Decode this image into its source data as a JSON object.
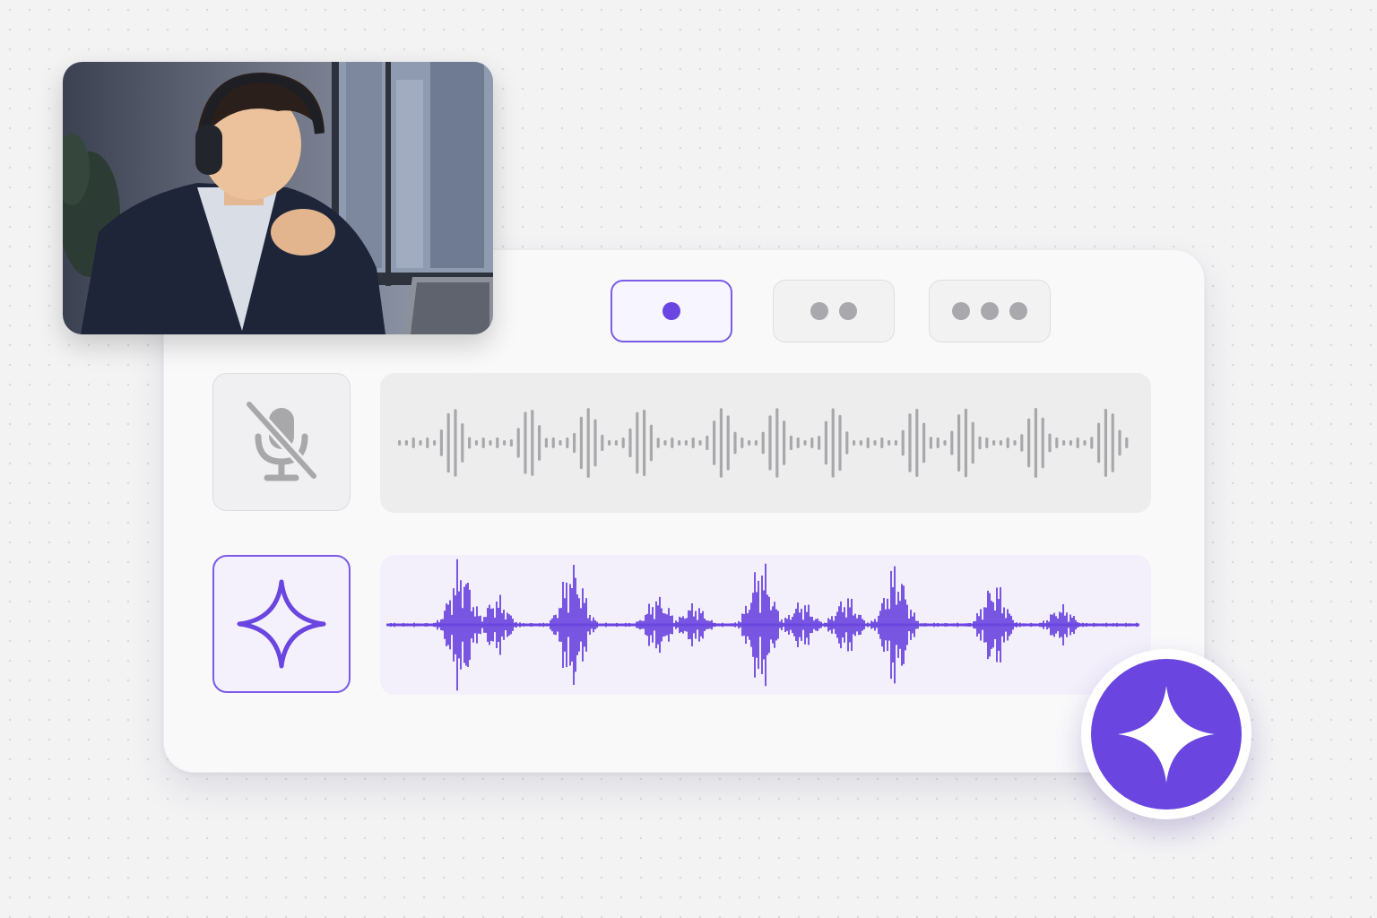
{
  "photo": {
    "subject": "man-with-headphones-at-laptop"
  },
  "modes": [
    {
      "id": "one",
      "dots": 1,
      "selected": true
    },
    {
      "id": "two",
      "dots": 2,
      "selected": false
    },
    {
      "id": "three",
      "dots": 3,
      "selected": false
    }
  ],
  "tracks": {
    "original": {
      "icon": "microphone-muted-icon",
      "state": "muted",
      "color": "#a8a8ab"
    },
    "ai": {
      "icon": "sparkle-icon",
      "state": "active",
      "color": "#6a45e0"
    }
  },
  "fab": {
    "icon": "sparkle-icon"
  },
  "colors": {
    "accent": "#6a45e0",
    "accent_border": "#7b5be6",
    "muted": "#a9a9ad"
  }
}
